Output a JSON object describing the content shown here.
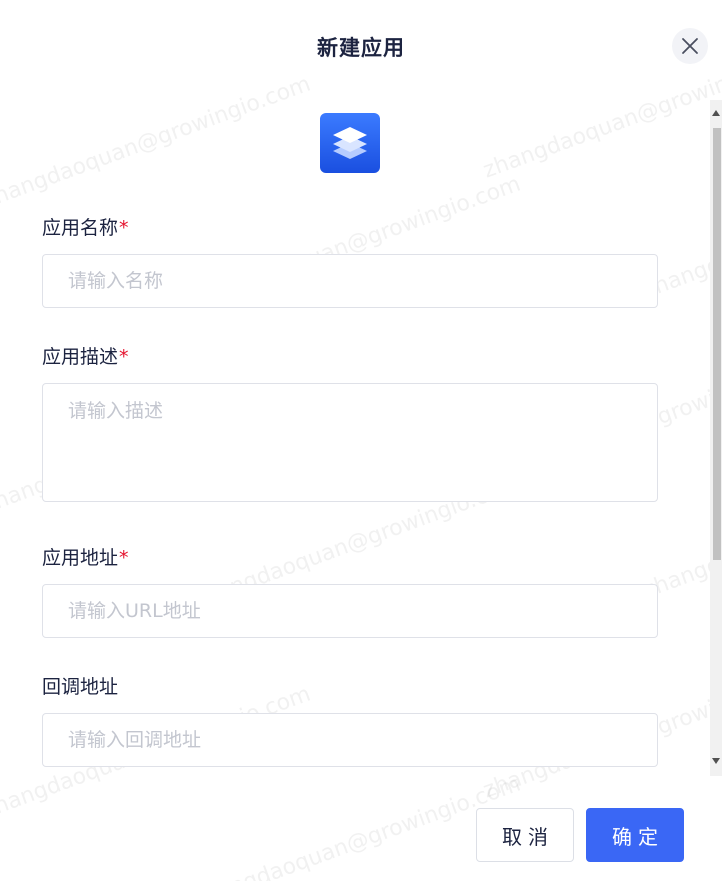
{
  "dialog": {
    "title": "新建应用",
    "close_icon": "close-icon",
    "app_icon": "layers-icon",
    "accent_color": "#3a67f5",
    "required_color": "#e5142f"
  },
  "form": {
    "name": {
      "label": "应用名称",
      "required_mark": "*",
      "value": "",
      "placeholder": "请输入名称"
    },
    "description": {
      "label": "应用描述",
      "required_mark": "*",
      "value": "",
      "placeholder": "请输入描述"
    },
    "url": {
      "label": "应用地址",
      "required_mark": "*",
      "value": "",
      "placeholder": "请输入URL地址"
    },
    "callback": {
      "label": "回调地址",
      "value": "",
      "placeholder": "请输入回调地址"
    }
  },
  "footer": {
    "cancel_label": "取消",
    "ok_label": "确定"
  },
  "watermark": "zhangdaoquan@growingio.com"
}
